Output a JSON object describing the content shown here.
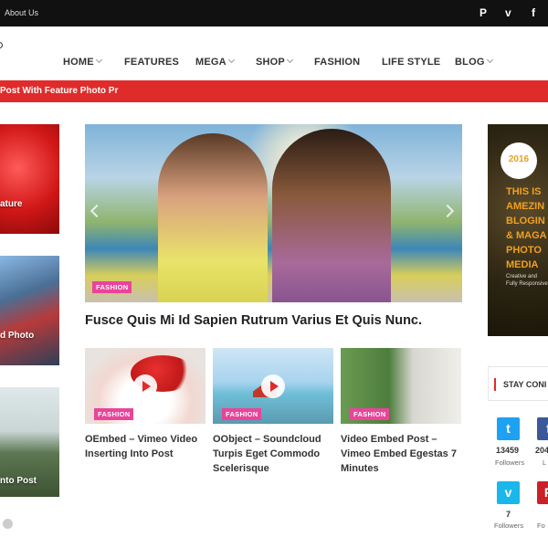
{
  "topbar": {
    "about_label": "About Us",
    "social_icons": [
      "pinterest-icon",
      "vimeo-icon",
      "facebook-icon"
    ],
    "social_glyphs": [
      "P",
      "v",
      "f"
    ]
  },
  "nav": {
    "items": [
      {
        "label": "HOME",
        "dropdown": true
      },
      {
        "label": "FEATURES",
        "dropdown": false
      },
      {
        "label": "MEGA",
        "dropdown": true
      },
      {
        "label": "SHOP",
        "dropdown": true
      },
      {
        "label": "FASHION",
        "dropdown": false
      },
      {
        "label": "LIFE STYLE",
        "dropdown": false
      },
      {
        "label": "BLOG",
        "dropdown": true
      }
    ]
  },
  "ticker": {
    "text": "Post With Feature Photo Pr",
    "color": "#e02b2b"
  },
  "left": {
    "cards": [
      {
        "caption": "ature"
      },
      {
        "caption": "d Photo"
      },
      {
        "caption": "nto Post"
      }
    ]
  },
  "hero": {
    "tag": "FASHION",
    "title": "Fusce Quis Mi Id Sapien Rutrum Varius Et Quis Nunc."
  },
  "posts": [
    {
      "tag": "FASHION",
      "title": "OEmbed – Vimeo Video Inserting Into Post"
    },
    {
      "tag": "FASHION",
      "title": "OObject – Soundcloud Turpis Eget Commodo Scelerisque"
    },
    {
      "tag": "FASHION",
      "title": "Video Embed Post – Vimeo Embed Egestas 7 Minutes"
    }
  ],
  "ad": {
    "year": "2016",
    "lines": [
      "THIS IS",
      "AMEZIN",
      "BLOGIN",
      "& MAGA",
      "PHOTO",
      "MEDIA"
    ],
    "small": [
      "Creative and",
      "Fully Responsive"
    ]
  },
  "sidebar": {
    "stay_label": "STAY CONI",
    "social": [
      {
        "icon": "twitter-icon",
        "glyph": "t",
        "color": "#1da1f2",
        "count": "13459",
        "label": "Followers"
      },
      {
        "icon": "facebook-icon",
        "glyph": "f",
        "color": "#3b5998",
        "count": "204",
        "label": "L"
      },
      {
        "icon": "vimeo-icon",
        "glyph": "v",
        "color": "#1ab7ea",
        "count": "7",
        "label": "Followers"
      },
      {
        "icon": "pinterest-icon",
        "glyph": "P",
        "color": "#cb2027",
        "count": "",
        "label": "Fo"
      }
    ]
  },
  "colors": {
    "accent": "#e02b2b",
    "tag": "#e8459a",
    "topbar": "#111111"
  }
}
